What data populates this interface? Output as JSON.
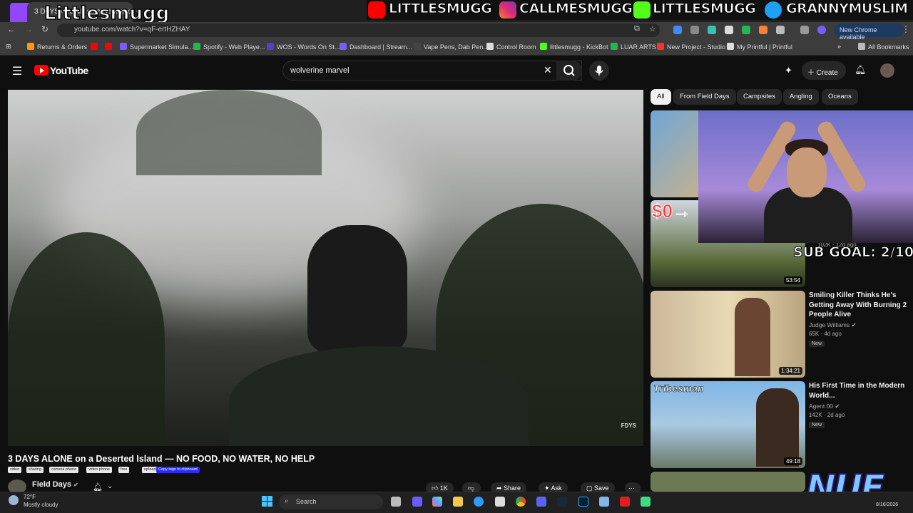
{
  "browser": {
    "tab_title": "3 DAYS ALONE on a Deserted",
    "url": "youtube.com/watch?v=qF-ertHZHAY",
    "new_chrome_label": "New Chrome available",
    "bookmarks": [
      {
        "label": "Returns & Orders",
        "color": "#ff9900"
      },
      {
        "label": "Supermarket Simula...",
        "color": "#7a5cff"
      },
      {
        "label": "Spotify - Web Playe...",
        "color": "#1db954"
      },
      {
        "label": "WOS - Words On St...",
        "color": "#5a3fc0"
      },
      {
        "label": "Dashboard | Stream...",
        "color": "#7a5cff"
      },
      {
        "label": "Vape Pens, Dab Pen...",
        "color": "#444444"
      },
      {
        "label": "Control Room",
        "color": "#dddddd"
      },
      {
        "label": "littlesmugg - KickBot",
        "color": "#53fc18"
      },
      {
        "label": "LUAR ARTS",
        "color": "#1db954"
      },
      {
        "label": "New Project - Studio",
        "color": "#ff3030"
      },
      {
        "label": "My Printful | Printful",
        "color": "#dddddd"
      }
    ],
    "all_bookmarks_label": "All Bookmarks"
  },
  "overlay": {
    "streamer_name": "Littlesmugg",
    "socials": [
      "LITTLESMUGG",
      "CALLMESMUGG",
      "LITTLESMUGG",
      "GRANNYMUSLIM"
    ],
    "sub_goal": "SUB GOAL: 2/10",
    "brand": "NUE"
  },
  "youtube": {
    "logo_text": "YouTube",
    "search_value": "wolverine marvel",
    "create_label": "Create",
    "video": {
      "title": "3 DAYS ALONE on a Deserted Island — NO FOOD, NO WATER, NO HELP",
      "watermark": "FDYS",
      "tags": [
        "video",
        "sharing",
        "camera phone",
        "video phone",
        "free",
        "upload"
      ],
      "copy_tags_label": "Copy tags to clipboard",
      "channel": "Field Days",
      "likes": "1K",
      "share_label": "Share",
      "ask_label": "Ask",
      "save_label": "Save"
    },
    "chips": [
      "All",
      "From Field Days",
      "Campsites",
      "Angling",
      "Oceans"
    ],
    "recommendations": [
      {
        "duration": "",
        "title": "",
        "channel": "",
        "meta": ""
      },
      {
        "duration": "53:54",
        "title": "",
        "channel": "",
        "meta": "102K · 12d ago",
        "thumb_text": "$0→"
      },
      {
        "duration": "1:34:21",
        "title": "Smiling Killer Thinks He's Getting Away With Burning 2 People Alive",
        "channel": "Judge Williams",
        "meta": "65K · 4d ago",
        "badge": "New"
      },
      {
        "duration": "49:18",
        "title": "His First Time in the Modern World...",
        "channel": "Agent 00",
        "meta": "142K · 2d ago",
        "badge": "New",
        "thumb_text": "Tribesman"
      }
    ]
  },
  "taskbar": {
    "temperature": "72°F",
    "weather": "Mostly cloudy",
    "search_label": "Search",
    "date": "8/16/2026"
  },
  "colors": {
    "youtube_red": "#ff0000",
    "twitch_purple": "#9146ff",
    "chip_active": "#f1f1f1"
  }
}
